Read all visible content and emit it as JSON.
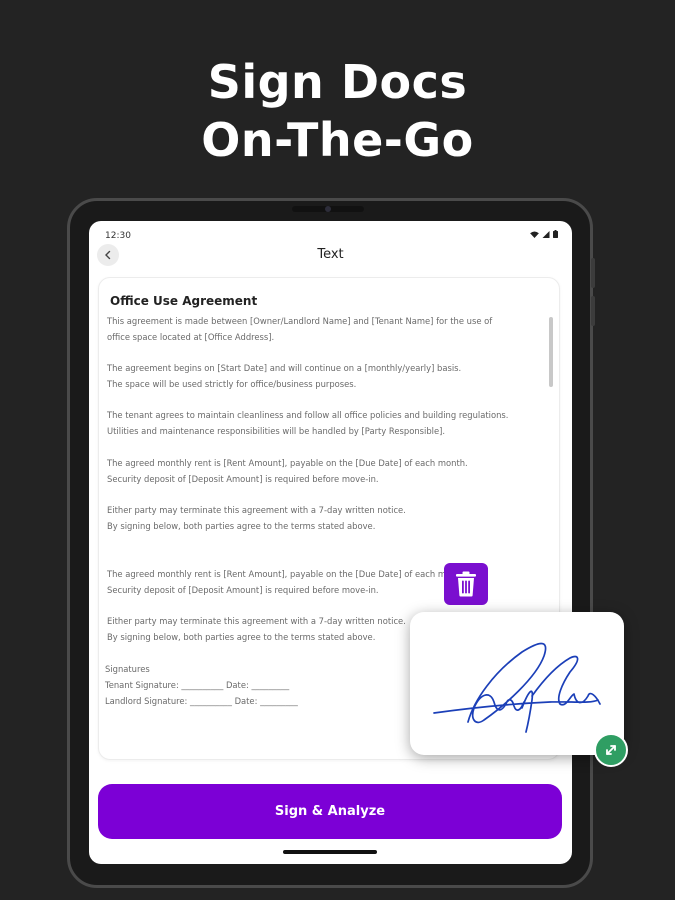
{
  "headline": {
    "line1": "Sign Docs",
    "line2": "On-The-Go"
  },
  "status_bar": {
    "time": "12:30"
  },
  "nav": {
    "title": "Text"
  },
  "document": {
    "title": "Office Use Agreement",
    "lines": [
      "This agreement is made between [Owner/Landlord Name] and [Tenant Name] for the use of",
      "office space located at [Office Address].",
      "The agreement begins on [Start Date] and will continue on a [monthly/yearly] basis.",
      "The space will be used strictly for office/business purposes.",
      "The tenant agrees to maintain cleanliness and follow all office policies and building regulations.",
      "Utilities and maintenance responsibilities will be handled by [Party Responsible].",
      "The agreed monthly rent is [Rent Amount], payable on the [Due Date] of each month.",
      "Security deposit of [Deposit Amount] is required before move-in.",
      "Either party may terminate this agreement with a 7-day written notice.",
      "By signing below, both parties agree to the terms stated above.",
      "The agreed monthly rent is [Rent Amount], payable on the [Due Date] of each month.",
      "Security deposit of [Deposit Amount] is required before move-in.",
      "Either party may terminate this agreement with a 7-day written notice.",
      "By signing below, both parties agree to the terms stated above.",
      "Signatures",
      "Tenant Signature: __________   Date: _________",
      "Landlord Signature: __________   Date: _________"
    ]
  },
  "actions": {
    "sign_button": "Sign & Analyze"
  },
  "icons": {
    "back": "chevron-left-icon",
    "delete": "trash-icon",
    "resize": "resize-diagonal-icon",
    "wifi": "wifi-icon",
    "signal": "signal-icon",
    "battery": "battery-icon"
  },
  "colors": {
    "background": "#232323",
    "accent": "#7c00d6",
    "delete_button": "#7a0fcf",
    "resize_button": "#2f9e63",
    "signature_ink": "#1b3fb8"
  }
}
